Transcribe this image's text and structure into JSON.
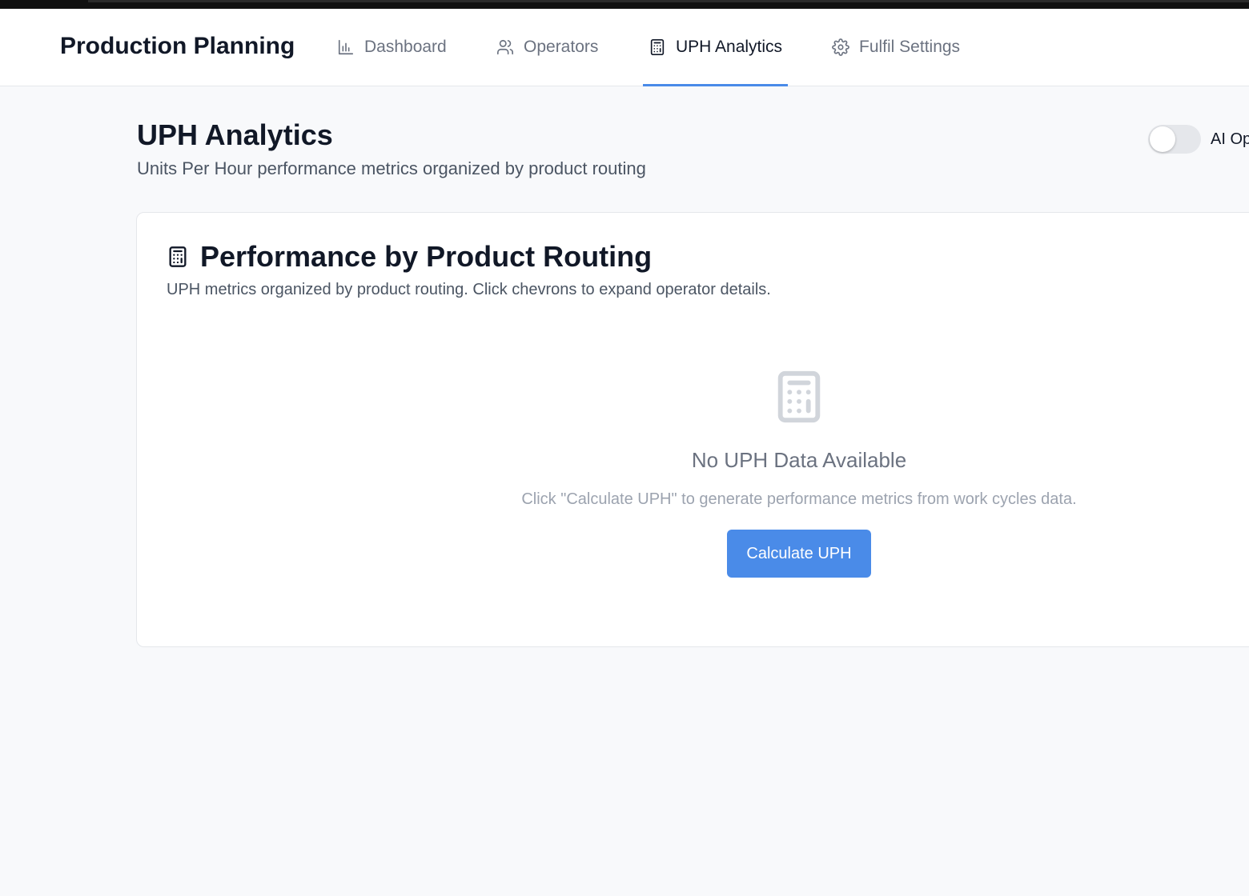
{
  "app": {
    "title": "Production Planning"
  },
  "nav": {
    "tabs": [
      {
        "label": "Dashboard",
        "icon": "bar-chart-icon",
        "active": false
      },
      {
        "label": "Operators",
        "icon": "users-icon",
        "active": false
      },
      {
        "label": "UPH Analytics",
        "icon": "calculator-icon",
        "active": true
      },
      {
        "label": "Fulfil Settings",
        "icon": "gear-icon",
        "active": false
      }
    ],
    "active_color": "#4a8be8"
  },
  "page": {
    "title": "UPH Analytics",
    "subtitle": "Units Per Hour performance metrics organized by product routing",
    "toggle": {
      "label": "AI Op",
      "enabled": false
    }
  },
  "card": {
    "icon": "calculator-icon",
    "title": "Performance by Product Routing",
    "description": "UPH metrics organized by product routing. Click chevrons to expand operator details.",
    "empty_state": {
      "icon": "calculator-icon",
      "title": "No UPH Data Available",
      "description": "Click \"Calculate UPH\" to generate performance metrics from work cycles data.",
      "button_label": "Calculate UPH",
      "button_color": "#4a8be8"
    }
  }
}
